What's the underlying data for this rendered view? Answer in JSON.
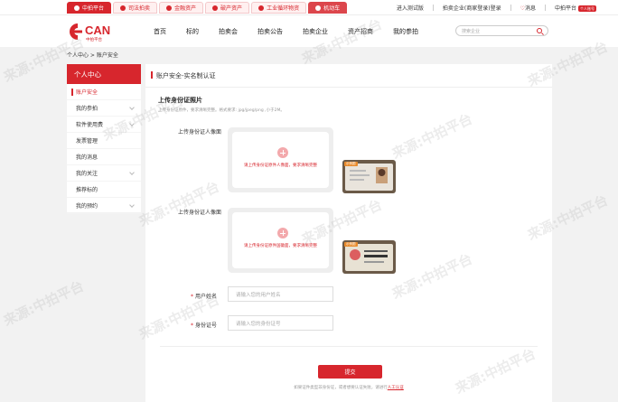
{
  "topbar": {
    "tabs": [
      {
        "label": "中拍平台",
        "icon": "home-icon"
      },
      {
        "label": "司法拍卖",
        "icon": "shield-icon"
      },
      {
        "label": "金融资产",
        "icon": "coin-icon"
      },
      {
        "label": "破产资产",
        "icon": "asset-icon"
      },
      {
        "label": "工业循环物资",
        "icon": "recycle-icon"
      },
      {
        "label": "机动车",
        "icon": "car-icon"
      }
    ],
    "links": {
      "test_version": "进入测试版",
      "login": "拍卖企业(商家登录)登录",
      "messages": "消息",
      "platform": "中拍平台",
      "platform_badge": "个人账号"
    }
  },
  "header": {
    "logo_text": "CAN",
    "logo_sub": "中拍平台",
    "nav": [
      "首页",
      "标的",
      "拍卖会",
      "拍卖公告",
      "拍卖企业",
      "资产招商",
      "我的参拍"
    ],
    "search_placeholder": "搜索企业"
  },
  "breadcrumb": "个人中心 > 账户安全",
  "sidebar": {
    "title": "个人中心",
    "items": [
      {
        "label": "账户安全",
        "active": true,
        "chevron": false
      },
      {
        "label": "我的参拍",
        "active": false,
        "chevron": true
      },
      {
        "label": "软件使用费",
        "active": false,
        "chevron": true
      },
      {
        "label": "发票管理",
        "active": false,
        "chevron": false
      },
      {
        "label": "我的消息",
        "active": false,
        "chevron": false
      },
      {
        "label": "我的关注",
        "active": false,
        "chevron": true
      },
      {
        "label": "推荐标的",
        "active": false,
        "chevron": false
      },
      {
        "label": "我的预约",
        "active": false,
        "chevron": true
      }
    ]
  },
  "panel": {
    "title": "账户安全-实名制认证",
    "section_title": "上传身份证照片",
    "section_hint": "上传身份证原件，要求清晰完整。格式要求: jpg/jpeg/png ,小于2M。",
    "front_label": "上传身份证人像面",
    "front_upload_text": "请上传身份证原件人像面，要求清晰完整",
    "back_label": "上传身份证人像面",
    "back_upload_text": "请上传身份证原件国徽面，要求清晰完整",
    "sample_tag": "示例图",
    "name_label": "用户姓名",
    "name_placeholder": "请输入您的用户姓名",
    "id_label": "身份证号",
    "id_placeholder": "请输入您的身份证号",
    "submit_label": "提交",
    "foot_note": "如果证件类型非身份证，或者想要认证失败，请进行",
    "foot_link": "人工认证"
  },
  "watermark": "来源:中拍平台",
  "colors": {
    "accent": "#d7262d",
    "background": "#f2f2f2"
  }
}
